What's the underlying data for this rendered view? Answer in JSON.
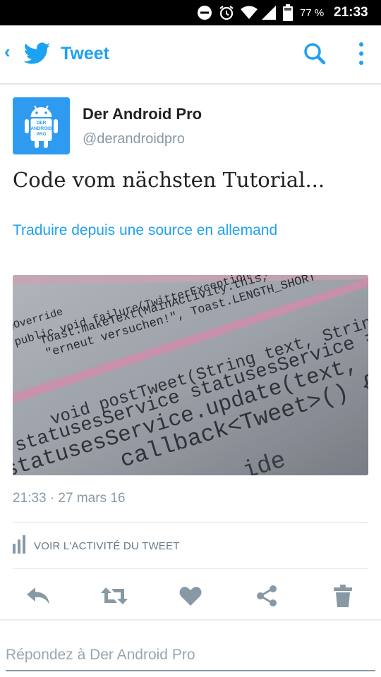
{
  "status_bar": {
    "battery_percent": "77 %",
    "time": "21:33",
    "icons": [
      "do-not-disturb-icon",
      "alarm-icon",
      "wifi-icon",
      "cell-signal-icon",
      "battery-icon"
    ]
  },
  "app_bar": {
    "title": "Tweet",
    "icons": [
      "back-icon",
      "twitter-bird-icon",
      "search-icon",
      "more-vert-icon"
    ],
    "accent": "#1da1f2"
  },
  "tweet": {
    "author_name": "Der Android Pro",
    "author_handle": "@derandroidpro",
    "avatar_text": [
      "DER",
      "ANDROID",
      "PRO"
    ],
    "text": "Code vom nächsten Tutorial...",
    "translate_link": "Traduire depuis une source en allemand",
    "timestamp": "21:33 · 27 mars 16",
    "activity_label": "VOIR L'ACTIVITÉ DU TWEET",
    "media": {
      "code_lines": [
        "@Override",
        "public void failure(TwitterException e) {",
        "Toast.makeText(MainActivity.this,",
        "\"erneut versuchen!\", Toast.LENGTH_SHORT",
        "void postTweet(String text, String mediaId",
        "statusesService statusesService = Twitter",
        "statusesService.update(text, null, fal",
        "callback<Tweet>() {",
        "ide"
      ]
    }
  },
  "actions": [
    "reply-icon",
    "retweet-icon",
    "like-icon",
    "share-icon",
    "delete-icon"
  ],
  "reply": {
    "placeholder": "Répondez à Der Android Pro"
  }
}
